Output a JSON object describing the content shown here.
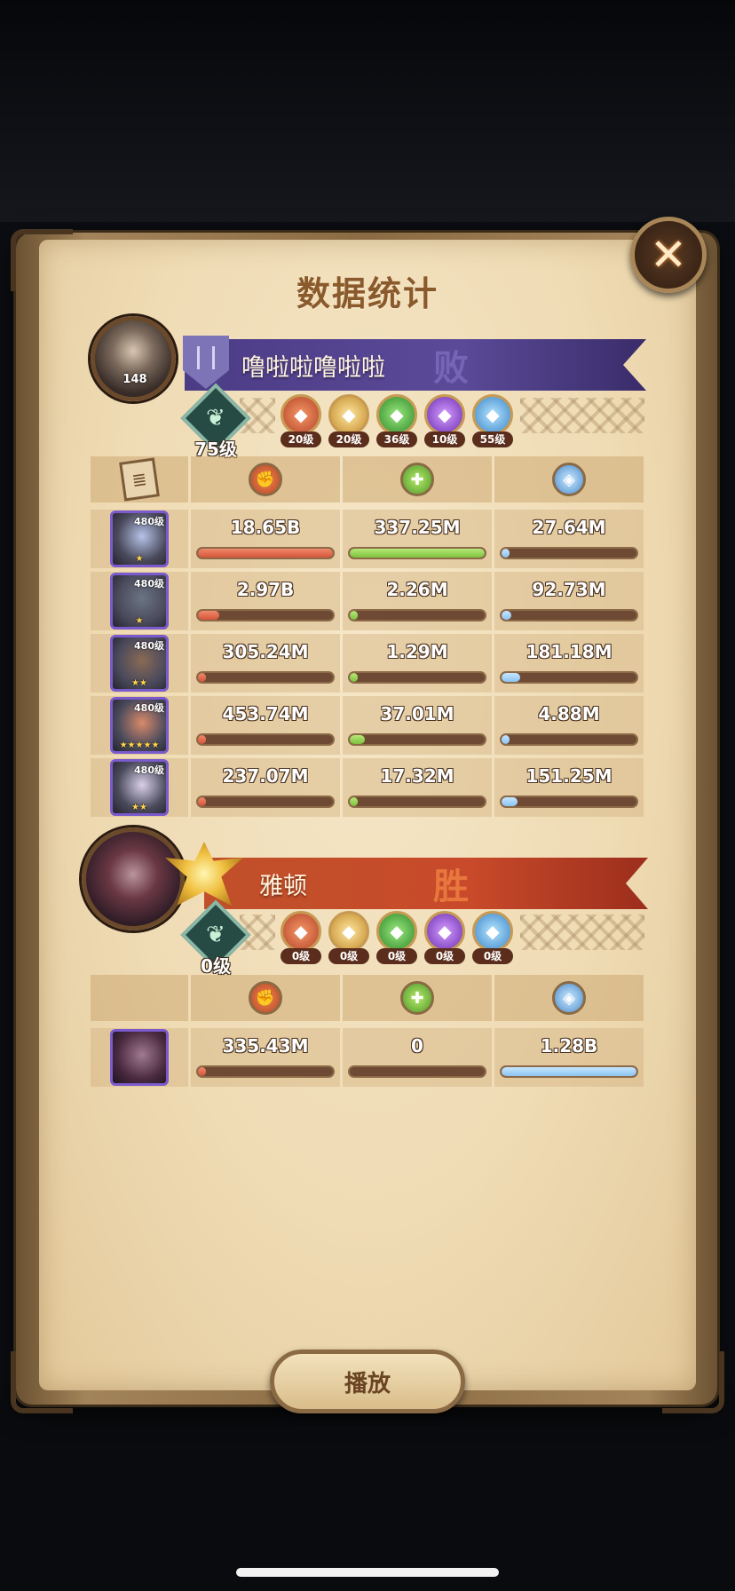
{
  "title": "数据统计",
  "close_label": "✕",
  "play_label": "播放",
  "team1": {
    "avatar_level": "148",
    "name": "噜啦啦噜啦啦",
    "result": "败",
    "tree_level": "75级",
    "factions": [
      {
        "icon": "lightbearer-faction-icon",
        "level": "20级",
        "color": "c-l"
      },
      {
        "icon": "mauler-faction-icon",
        "level": "20级",
        "color": "c-m"
      },
      {
        "icon": "wilder-faction-icon",
        "level": "36级",
        "color": "c-w"
      },
      {
        "icon": "graveborn-faction-icon",
        "level": "10级",
        "color": "c-g"
      },
      {
        "icon": "celestial-faction-icon",
        "level": "55级",
        "color": "c-c"
      }
    ],
    "rows": [
      {
        "hero_level": "480级",
        "stars": "★",
        "damage": "18.65B",
        "damage_pct": 1.0,
        "heal": "337.25M",
        "heal_pct": 1.0,
        "shield": "27.64M",
        "shield_pct": 0.03
      },
      {
        "hero_level": "480级",
        "stars": "★",
        "damage": "2.97B",
        "damage_pct": 0.16,
        "heal": "2.26M",
        "heal_pct": 0.01,
        "shield": "92.73M",
        "shield_pct": 0.07
      },
      {
        "hero_level": "480级",
        "stars": "★★",
        "damage": "305.24M",
        "damage_pct": 0.016,
        "heal": "1.29M",
        "heal_pct": 0.004,
        "shield": "181.18M",
        "shield_pct": 0.14
      },
      {
        "hero_level": "480级",
        "stars": "★★★★★",
        "damage": "453.74M",
        "damage_pct": 0.024,
        "heal": "37.01M",
        "heal_pct": 0.11,
        "shield": "4.88M",
        "shield_pct": 0.004
      },
      {
        "hero_level": "480级",
        "stars": "★★",
        "damage": "237.07M",
        "damage_pct": 0.013,
        "heal": "17.32M",
        "heal_pct": 0.05,
        "shield": "151.25M",
        "shield_pct": 0.12
      }
    ]
  },
  "team2": {
    "name": "雅顿",
    "result": "胜",
    "tree_level": "0级",
    "factions": [
      {
        "icon": "lightbearer-faction-icon",
        "level": "0级",
        "color": "c-l"
      },
      {
        "icon": "mauler-faction-icon",
        "level": "0级",
        "color": "c-m"
      },
      {
        "icon": "wilder-faction-icon",
        "level": "0级",
        "color": "c-w"
      },
      {
        "icon": "graveborn-faction-icon",
        "level": "0级",
        "color": "c-g"
      },
      {
        "icon": "celestial-faction-icon",
        "level": "0级",
        "color": "c-c"
      }
    ],
    "rows": [
      {
        "damage": "335.43M",
        "damage_pct": 0.018,
        "heal": "0",
        "heal_pct": 0.0,
        "shield": "1.28B",
        "shield_pct": 1.0
      }
    ]
  }
}
